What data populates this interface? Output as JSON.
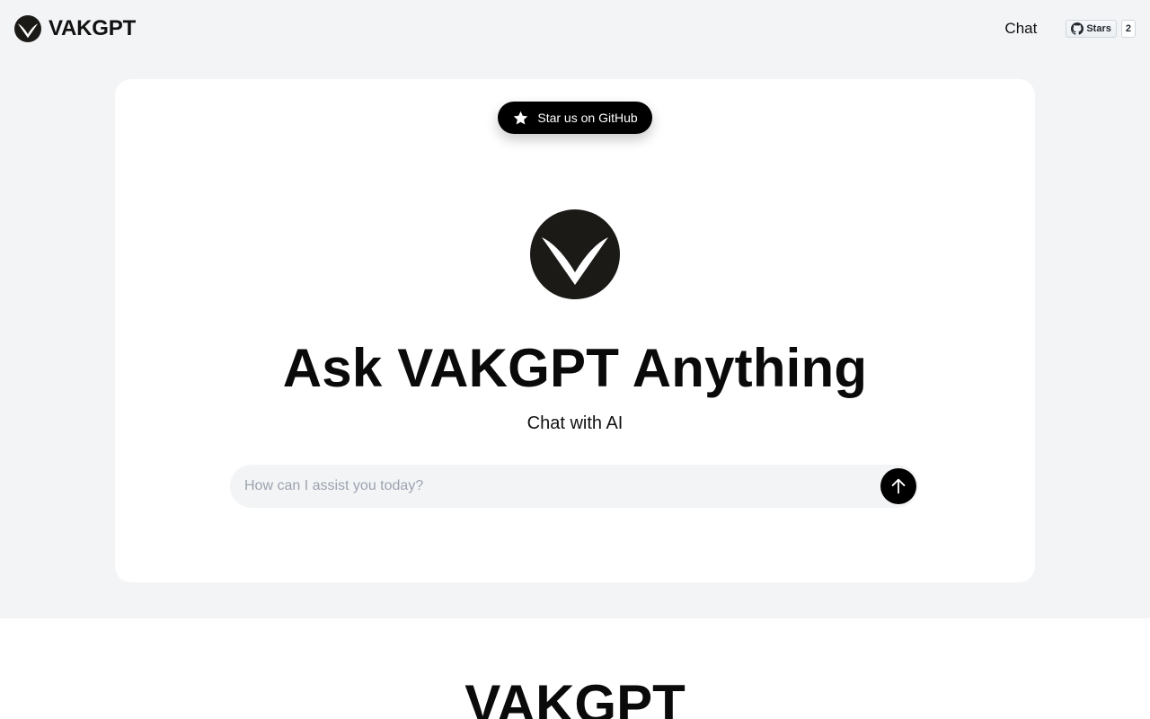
{
  "header": {
    "brand_name": "VAKGPT",
    "logo_icon": "vakgpt-logo-icon",
    "nav_chat_label": "Chat",
    "github_button": {
      "label": "Stars",
      "count": "2",
      "icon": "github-icon"
    }
  },
  "hero": {
    "star_button_label": "Star us on GitHub",
    "star_icon": "star-icon",
    "logo_icon": "vakgpt-logo-icon",
    "title": "Ask VAKGPT Anything",
    "subtitle": "Chat with AI",
    "chat_input": {
      "value": "",
      "placeholder": "How can I assist you today?"
    },
    "send_icon": "arrow-up-icon"
  },
  "lower_section": {
    "title": "VAKGPT"
  },
  "colors": {
    "page_background": "#f3f4f6",
    "card_background": "#ffffff",
    "primary": "#000000",
    "logo_dark": "#1c1a17",
    "placeholder": "#9ca3af"
  }
}
